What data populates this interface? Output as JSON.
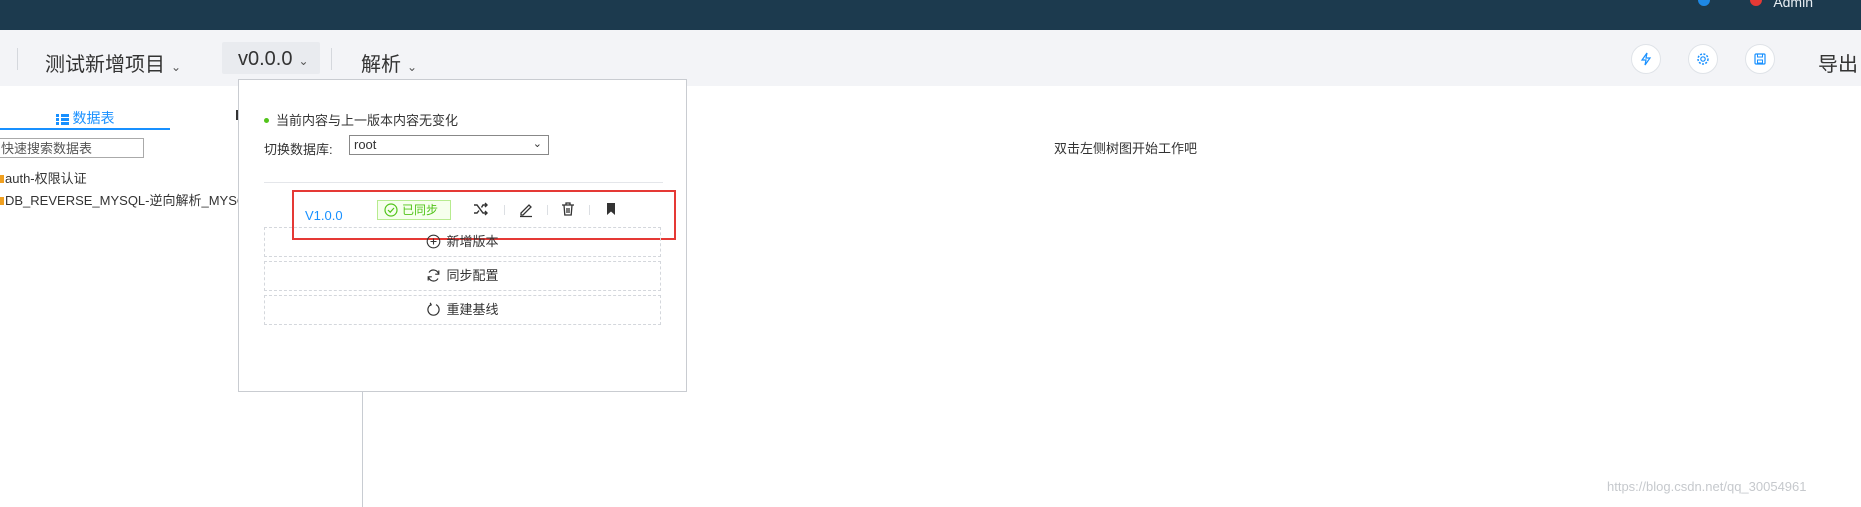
{
  "header": {
    "user": "Admin"
  },
  "toolbar": {
    "project_name": "测试新增项目",
    "version": "v0.0.0",
    "analyze": "解析",
    "export": "导出"
  },
  "sidebar": {
    "tab_label": "数据表",
    "search_placeholder": "快速搜索数据表",
    "items": [
      {
        "label": "auth-权限认证"
      },
      {
        "label": "DB_REVERSE_MYSQL-逆向解析_MYSQ"
      }
    ]
  },
  "main": {
    "hint": "双击左侧树图开始工作吧"
  },
  "popover": {
    "status": "当前内容与上一版本内容无变化",
    "switch_db_label": "切换数据库:",
    "db_value": "root",
    "version_row": {
      "version": "V1.0.0",
      "badge": "已同步"
    },
    "buttons": {
      "add_version": "新增版本",
      "sync_config": "同步配置",
      "rebuild_baseline": "重建基线"
    }
  },
  "watermark": "https://blog.csdn.net/qq_30054961",
  "colors": {
    "topbar": "#1c3a4e",
    "accent": "#1890ff",
    "success": "#52c41a",
    "highlight": "#e53935"
  }
}
